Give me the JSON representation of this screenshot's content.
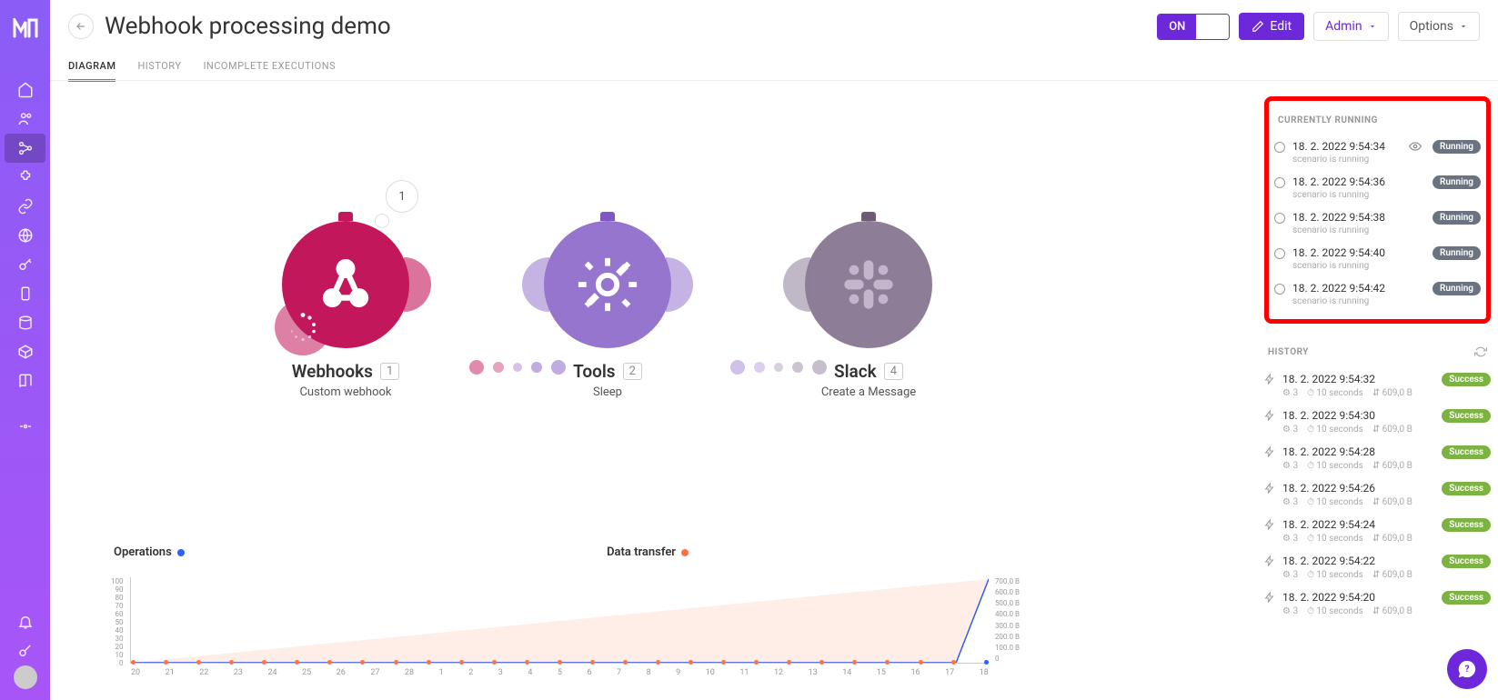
{
  "pageTitle": "Webhook processing demo",
  "tabs": {
    "diagram": "DIAGRAM",
    "history": "HISTORY",
    "incomplete": "INCOMPLETE EXECUTIONS"
  },
  "headerButtons": {
    "on": "ON",
    "edit": "Edit",
    "admin": "Admin",
    "options": "Options"
  },
  "nodes": {
    "webhooks": {
      "title": "Webhooks",
      "badge": "1",
      "subtitle": "Custom webhook",
      "bubble": "1"
    },
    "tools": {
      "title": "Tools",
      "badge": "2",
      "subtitle": "Sleep"
    },
    "slack": {
      "title": "Slack",
      "badge": "4",
      "subtitle": "Create a Message"
    }
  },
  "chart": {
    "operationsLabel": "Operations",
    "dataTransferLabel": "Data transfer",
    "yLeft": [
      "100",
      "90",
      "80",
      "70",
      "60",
      "50",
      "40",
      "30",
      "20",
      "10",
      "0"
    ],
    "yRight": [
      "700.0 B",
      "600.0 B",
      "500.0 B",
      "400.0 B",
      "300.0 B",
      "200.0 B",
      "100.0 B",
      "0"
    ],
    "x": [
      "20",
      "21",
      "22",
      "23",
      "24",
      "25",
      "26",
      "27",
      "28",
      "1",
      "2",
      "3",
      "4",
      "5",
      "6",
      "7",
      "8",
      "9",
      "10",
      "11",
      "12",
      "13",
      "14",
      "15",
      "16",
      "17",
      "18"
    ]
  },
  "rightPanel": {
    "currentlyRunning": "CURRENTLY RUNNING",
    "historyHeading": "HISTORY",
    "scenarioRunning": "scenario is running",
    "runningBadge": "Running",
    "successBadge": "Success",
    "running": [
      {
        "time": "18. 2. 2022 9:54:34",
        "watched": true
      },
      {
        "time": "18. 2. 2022 9:54:36"
      },
      {
        "time": "18. 2. 2022 9:54:38"
      },
      {
        "time": "18. 2. 2022 9:54:40"
      },
      {
        "time": "18. 2. 2022 9:54:42"
      }
    ],
    "history": [
      {
        "time": "18. 2. 2022 9:54:32",
        "ops": "3",
        "dur": "10 seconds",
        "size": "609,0 B"
      },
      {
        "time": "18. 2. 2022 9:54:30",
        "ops": "3",
        "dur": "10 seconds",
        "size": "609,0 B"
      },
      {
        "time": "18. 2. 2022 9:54:28",
        "ops": "3",
        "dur": "10 seconds",
        "size": "609,0 B"
      },
      {
        "time": "18. 2. 2022 9:54:26",
        "ops": "3",
        "dur": "10 seconds",
        "size": "609,0 B"
      },
      {
        "time": "18. 2. 2022 9:54:24",
        "ops": "3",
        "dur": "10 seconds",
        "size": "609,0 B"
      },
      {
        "time": "18. 2. 2022 9:54:22",
        "ops": "3",
        "dur": "10 seconds",
        "size": "609,0 B"
      },
      {
        "time": "18. 2. 2022 9:54:20",
        "ops": "3",
        "dur": "10 seconds",
        "size": "609,0 B"
      }
    ]
  },
  "chart_data": {
    "type": "line",
    "x": [
      "20",
      "21",
      "22",
      "23",
      "24",
      "25",
      "26",
      "27",
      "28",
      "1",
      "2",
      "3",
      "4",
      "5",
      "6",
      "7",
      "8",
      "9",
      "10",
      "11",
      "12",
      "13",
      "14",
      "15",
      "16",
      "17",
      "18"
    ],
    "series": [
      {
        "name": "Operations",
        "color": "#2962ff",
        "values": [
          0,
          0,
          0,
          0,
          0,
          0,
          0,
          0,
          0,
          0,
          0,
          0,
          0,
          0,
          0,
          0,
          0,
          0,
          0,
          0,
          0,
          0,
          0,
          0,
          0,
          0,
          100
        ],
        "yaxis": "left"
      },
      {
        "name": "Data transfer",
        "color": "#ff7043",
        "values": [
          0,
          0,
          0,
          0,
          0,
          0,
          0,
          0,
          0,
          0,
          0,
          0,
          0,
          0,
          0,
          0,
          0,
          0,
          0,
          0,
          0,
          0,
          0,
          0,
          0,
          0,
          700
        ],
        "yaxis": "right",
        "unit": "B"
      }
    ],
    "yLeft": {
      "label": "Operations",
      "min": 0,
      "max": 100
    },
    "yRight": {
      "label": "Data transfer (B)",
      "min": 0,
      "max": 700
    }
  }
}
